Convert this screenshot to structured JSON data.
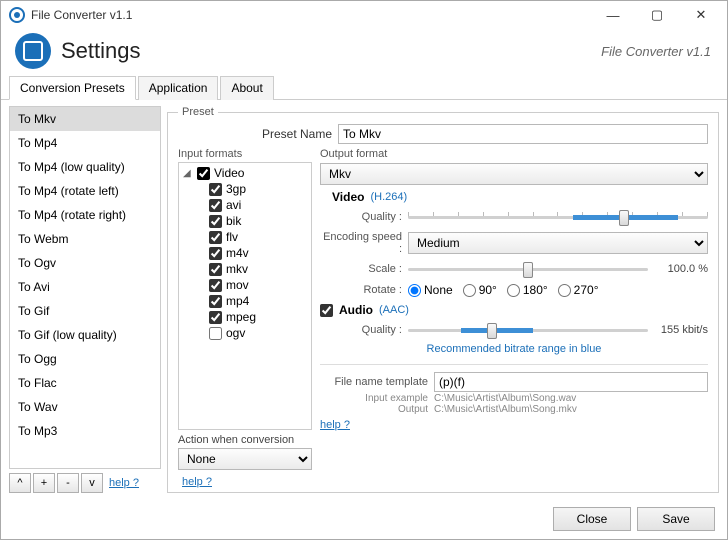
{
  "titlebar": {
    "title": "File Converter v1.1"
  },
  "header": {
    "title": "Settings",
    "version": "File Converter v1.1"
  },
  "tabs": [
    "Conversion Presets",
    "Application",
    "About"
  ],
  "activeTab": 0,
  "presets": [
    "To Mkv",
    "To Mp4",
    "To Mp4 (low quality)",
    "To Mp4 (rotate left)",
    "To Mp4 (rotate right)",
    "To Webm",
    "To Ogv",
    "To Avi",
    "To Gif",
    "To Gif (low quality)",
    "To Ogg",
    "To Flac",
    "To Wav",
    "To Mp3"
  ],
  "selectedPreset": 0,
  "presetButtons": {
    "up": "^",
    "add": "+",
    "remove": "-",
    "down": "v",
    "help": "help ?"
  },
  "presetGroup": {
    "legend": "Preset",
    "nameLabel": "Preset Name",
    "nameValue": "To Mkv",
    "inputFormatsLabel": "Input formats",
    "tree": {
      "root": "Video",
      "children": [
        "3gp",
        "avi",
        "bik",
        "flv",
        "m4v",
        "mkv",
        "mov",
        "mp4",
        "mpeg",
        "ogv"
      ]
    },
    "actionLabel": "Action when conversion",
    "actionValue": "None",
    "help": "help ?",
    "outputFormatLabel": "Output format",
    "outputFormatValue": "Mkv",
    "video": {
      "title": "Video",
      "codec": "(H.264)",
      "qualityLabel": "Quality :",
      "encodingLabel": "Encoding speed :",
      "encodingValue": "Medium",
      "scaleLabel": "Scale :",
      "scaleValue": "100.0 %",
      "rotateLabel": "Rotate :",
      "rotateOptions": [
        "None",
        "90°",
        "180°",
        "270°"
      ],
      "rotateSelected": 0
    },
    "audio": {
      "title": "Audio",
      "codec": "(AAC)",
      "enabled": true,
      "qualityLabel": "Quality :",
      "qualityValue": "155 kbit/s",
      "rec": "Recommended bitrate range in blue"
    },
    "fileTemplate": {
      "label": "File name template",
      "value": "(p)(f)",
      "inputExampleLabel": "Input example",
      "inputExample": "C:\\Music\\Artist\\Album\\Song.wav",
      "outputLabel": "Output",
      "outputExample": "C:\\Music\\Artist\\Album\\Song.mkv",
      "help": "help ?"
    }
  },
  "footer": {
    "close": "Close",
    "save": "Save"
  }
}
